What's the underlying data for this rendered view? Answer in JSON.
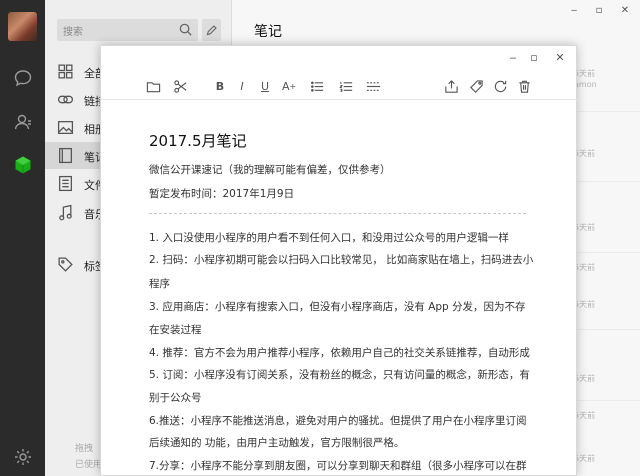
{
  "sidebar": {
    "search_placeholder": "搜索",
    "categories": [
      {
        "label": "全部",
        "icon": "grid-icon"
      },
      {
        "label": "链接",
        "icon": "link-icon"
      },
      {
        "label": "相册",
        "icon": "image-icon"
      },
      {
        "label": "笔记",
        "icon": "notebook-icon",
        "active": true
      },
      {
        "label": "文件",
        "icon": "file-icon"
      },
      {
        "label": "音乐",
        "icon": "music-icon"
      },
      {
        "label": "标签",
        "icon": "tag-icon"
      }
    ],
    "footer_line1": "拖拽",
    "footer_line2": "已使用"
  },
  "main": {
    "title": "笔记",
    "items_meta": [
      {
        "time": "5天前",
        "author": "amon"
      },
      {
        "time": "5天前",
        "author": ""
      },
      {
        "time": "5天前",
        "author": ""
      },
      {
        "time": "5天前",
        "author": ""
      },
      {
        "time": "5天前",
        "author": ""
      },
      {
        "time": "5天前",
        "author": ""
      },
      {
        "time": "5天前",
        "author": ""
      },
      {
        "time": "5天前",
        "author": ""
      }
    ]
  },
  "editor": {
    "title": "2017.5月笔记",
    "subtitle": "微信公开课速记（我的理解可能有偏差，仅供参考）",
    "publish": "暂定发布时间：2017年1月9日",
    "lines": [
      "1. 入口没使用小程序的用户看不到任何入口，和没用过公众号的用户逻辑一样",
      "2. 扫码：小程序初期可能会以扫码入口比较常见， 比如商家贴在墙上，扫码进去小",
      "程序",
      "3.  应用商店：小程序有搜索入口，但没有小程序商店，没有  App  分发，因为不存",
      "在安装过程",
      "4. 推荐：官方不会为用户推荐小程序，依赖用户自己的社交关系链推荐，自动形成",
      "5.  订阅：小程序没有订阅关系，没有粉丝的概念，只有访问量的概念，新形态，有",
      "别于公众号",
      "6.推送：小程序不能推送消息，避免对用户的骚扰。但提供了用户在小程序里订阅",
      "后续通知的          功能，由用户主动触发，官方限制很严格。",
      "7.分享：小程序不能分享到朋友圈，可以分享到聊天和群组（很多小程序可以在群"
    ]
  },
  "colors": {
    "accent": "#1aad19",
    "rail": "#2b2b2b"
  }
}
